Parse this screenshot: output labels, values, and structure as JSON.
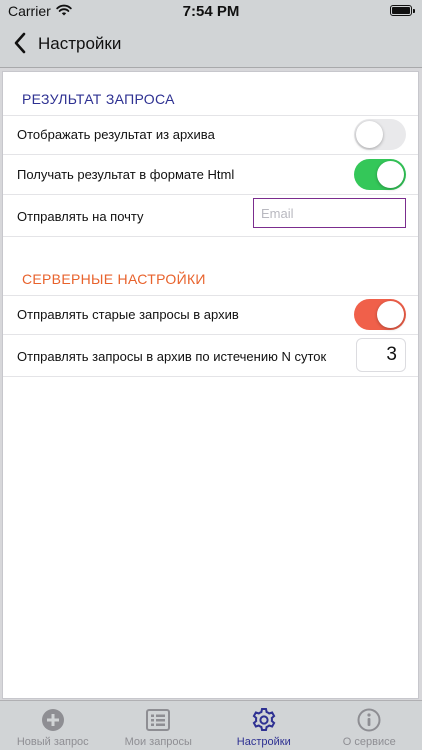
{
  "status_bar": {
    "carrier": "Carrier",
    "time": "7:54 PM"
  },
  "nav": {
    "title": "Настройки",
    "back_icon": "chevron-left-icon"
  },
  "sections": {
    "result": {
      "header": "РЕЗУЛЬТАТ ЗАПРОСА",
      "header_color": "#2e3192",
      "rows": {
        "archive": {
          "label": "Отображать результат из архива",
          "on": false
        },
        "html": {
          "label": "Получать результат в формате Html",
          "on": true
        },
        "email": {
          "label": "Отправлять на почту",
          "value": "",
          "placeholder": "Email"
        }
      }
    },
    "server": {
      "header": "СЕРВЕРНЫЕ НАСТРОЙКИ",
      "header_color": "#e8622c",
      "rows": {
        "old_requests": {
          "label": "Отправлять старые запросы в архив",
          "on": true
        },
        "days": {
          "label": "Отправлять запросы в архив по истечению N суток",
          "value": "3"
        }
      }
    }
  },
  "colors": {
    "toggle_off": "#e9e9eb",
    "toggle_green": "#34c759",
    "toggle_orange": "#f0604a",
    "tab_active": "#2e3192",
    "tab_inactive": "#8e8e93"
  },
  "tabs": [
    {
      "label": "Новый запрос",
      "icon": "plus-circle-icon",
      "active": false
    },
    {
      "label": "Мои запросы",
      "icon": "list-icon",
      "active": false
    },
    {
      "label": "Настройки",
      "icon": "gear-icon",
      "active": true
    },
    {
      "label": "О сервисе",
      "icon": "info-circle-icon",
      "active": false
    }
  ]
}
